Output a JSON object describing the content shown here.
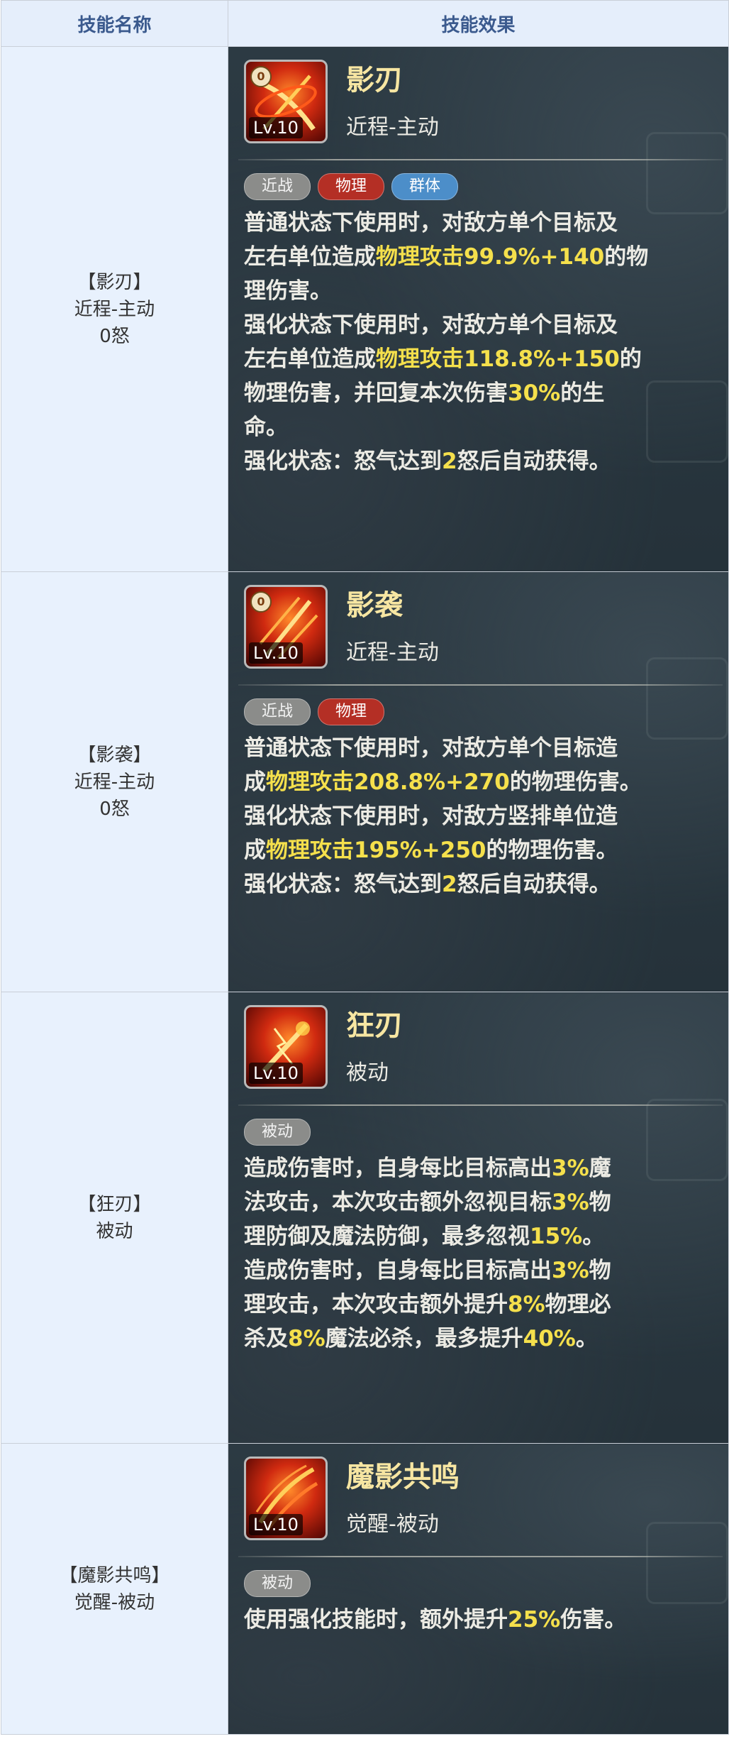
{
  "header": {
    "col_name": "技能名称",
    "col_effect": "技能效果"
  },
  "skills": [
    {
      "name_label": "【影刃】",
      "type_label": "近程-主动",
      "rage_label": "0怒",
      "icon_name": "blade-slash-icon",
      "icon_rage": "0",
      "icon_level": "Lv.10",
      "title": "影刃",
      "type_text": "近程-主动",
      "tags": [
        "近战",
        "物理",
        "群体"
      ],
      "desc": [
        [
          {
            "t": "普通状态下使用时，对敌方单个目标及"
          }
        ],
        [
          {
            "t": "左右单位造成"
          },
          {
            "t": "物理攻击99.9%+140",
            "h": true
          },
          {
            "t": "的物"
          }
        ],
        [
          {
            "t": "理伤害。"
          }
        ],
        [
          {
            "t": "强化状态下使用时，对敌方单个目标及"
          }
        ],
        [
          {
            "t": "左右单位造成"
          },
          {
            "t": "物理攻击118.8%+150",
            "h": true
          },
          {
            "t": "的"
          }
        ],
        [
          {
            "t": "物理伤害，并回复本次伤害"
          },
          {
            "t": "30%",
            "h": true
          },
          {
            "t": "的生"
          }
        ],
        [
          {
            "t": "命。"
          }
        ],
        [
          {
            "t": "强化状态：怒气达到"
          },
          {
            "t": "2",
            "h": true
          },
          {
            "t": "怒后自动获得。"
          }
        ]
      ]
    },
    {
      "name_label": "【影袭】",
      "type_label": "近程-主动",
      "rage_label": "0怒",
      "icon_name": "claw-strike-icon",
      "icon_rage": "0",
      "icon_level": "Lv.10",
      "title": "影袭",
      "type_text": "近程-主动",
      "tags": [
        "近战",
        "物理"
      ],
      "desc": [
        [
          {
            "t": "普通状态下使用时，对敌方单个目标造"
          }
        ],
        [
          {
            "t": "成"
          },
          {
            "t": "物理攻击208.8%+270",
            "h": true
          },
          {
            "t": "的物理伤害。"
          }
        ],
        [
          {
            "t": "强化状态下使用时，对敌方竖排单位造"
          }
        ],
        [
          {
            "t": "成"
          },
          {
            "t": "物理攻击195%+250",
            "h": true
          },
          {
            "t": "的物理伤害。"
          }
        ],
        [
          {
            "t": "强化状态：怒气达到"
          },
          {
            "t": "2",
            "h": true
          },
          {
            "t": "怒后自动获得。"
          }
        ]
      ]
    },
    {
      "name_label": "【狂刃】",
      "type_label": "被动",
      "icon_name": "frenzy-blade-icon",
      "icon_level": "Lv.10",
      "title": "狂刃",
      "type_text": "被动",
      "tags": [
        "被动"
      ],
      "desc": [
        [
          {
            "t": "造成伤害时，自身每比目标高出"
          },
          {
            "t": "3%",
            "h": true
          },
          {
            "t": "魔"
          }
        ],
        [
          {
            "t": "法攻击，本次攻击额外忽视目标"
          },
          {
            "t": "3%",
            "h": true
          },
          {
            "t": "物"
          }
        ],
        [
          {
            "t": "理防御及魔法防御，最多忽视"
          },
          {
            "t": "15%",
            "h": true
          },
          {
            "t": "。"
          }
        ],
        [
          {
            "t": "造成伤害时，自身每比目标高出"
          },
          {
            "t": "3%",
            "h": true
          },
          {
            "t": "物"
          }
        ],
        [
          {
            "t": "理攻击，本次攻击额外提升"
          },
          {
            "t": "8%",
            "h": true
          },
          {
            "t": "物理必"
          }
        ],
        [
          {
            "t": "杀及"
          },
          {
            "t": "8%",
            "h": true
          },
          {
            "t": "魔法必杀，最多提升"
          },
          {
            "t": "40%",
            "h": true
          },
          {
            "t": "。"
          }
        ]
      ]
    },
    {
      "name_label": "【魔影共鸣】",
      "type_label": "觉醒-被动",
      "icon_name": "shadow-resonance-icon",
      "icon_level": "Lv.10",
      "title": "魔影共鸣",
      "type_text": "觉醒-被动",
      "tags": [
        "被动"
      ],
      "desc": [
        [
          {
            "t": "使用强化技能时，额外提升"
          },
          {
            "t": "25%",
            "h": true
          },
          {
            "t": "伤害。"
          }
        ]
      ]
    }
  ],
  "colors": {
    "header_text": "#3b5a8e",
    "highlight": "#f5e04c",
    "tag_melee": "#8b8c8a",
    "tag_physical": "#b42f25",
    "tag_aoe": "#4c8ec9"
  }
}
